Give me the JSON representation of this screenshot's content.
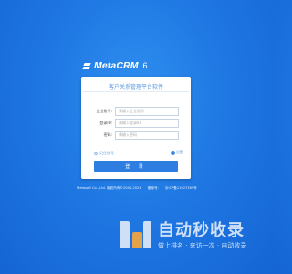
{
  "brand": {
    "name": "MetaCRM",
    "version": "6"
  },
  "login": {
    "title": "客户关系管理平台软件",
    "fields": [
      {
        "label": "企业账号:",
        "placeholder": "请输入企业账号",
        "value": ""
      },
      {
        "label": "登录ID:",
        "placeholder": "请输入登录ID",
        "value": ""
      },
      {
        "label": "密码:",
        "placeholder": "请输入密码",
        "value": ""
      }
    ],
    "remember_label": "记住账号",
    "settings_label": "设置",
    "submit_label": "登 录"
  },
  "footer": {
    "copyright": "Metasoft Co., Ltd. 版权所有©2006-2024",
    "record_label": "备案号:",
    "icp": "京ICP备11027365号"
  },
  "watermark": {
    "title": "自动秒收录",
    "subtitle": "做上排名 · 来访一次 · 自动收录"
  },
  "colors": {
    "background": "#1f78e3",
    "accent": "#2d7ee0",
    "title": "#5f9be6"
  }
}
